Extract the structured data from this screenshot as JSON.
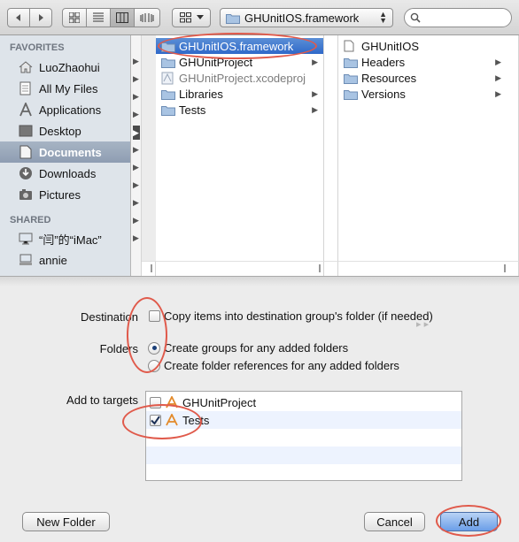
{
  "toolbar": {
    "path_label": "GHUnitIOS.framework",
    "search_placeholder": ""
  },
  "sidebar": {
    "favorites_header": "FAVORITES",
    "favorites": [
      {
        "label": "LuoZhaohui",
        "icon": "home-icon"
      },
      {
        "label": "All My Files",
        "icon": "all-files-icon"
      },
      {
        "label": "Applications",
        "icon": "applications-icon"
      },
      {
        "label": "Desktop",
        "icon": "desktop-icon"
      },
      {
        "label": "Documents",
        "icon": "documents-icon",
        "selected": true
      },
      {
        "label": "Downloads",
        "icon": "downloads-icon"
      },
      {
        "label": "Pictures",
        "icon": "pictures-icon"
      }
    ],
    "shared_header": "SHARED",
    "shared": [
      {
        "label": "“闫”的“iMac”",
        "icon": "imac-icon"
      },
      {
        "label": "annie",
        "icon": "computer-icon"
      }
    ]
  },
  "browser": {
    "column1": [
      {
        "label": "GHUnitIOS.framework",
        "icon": "folder-icon",
        "selected": true
      },
      {
        "label": "GHUnitProject",
        "icon": "folder-icon"
      },
      {
        "label": "GHUnitProject.xcodeproj",
        "icon": "xcodeproj-icon",
        "dim": true
      },
      {
        "label": "Libraries",
        "icon": "folder-icon"
      },
      {
        "label": "Tests",
        "icon": "folder-icon"
      }
    ],
    "column2": [
      {
        "label": "GHUnitIOS",
        "icon": "file-icon"
      },
      {
        "label": "Headers",
        "icon": "folder-icon"
      },
      {
        "label": "Resources",
        "icon": "folder-icon"
      },
      {
        "label": "Versions",
        "icon": "folder-icon"
      }
    ]
  },
  "options": {
    "destination_label": "Destination",
    "copy_items_label": "Copy items into destination group's folder (if needed)",
    "copy_items_checked": false,
    "folders_label": "Folders",
    "create_groups_label": "Create groups for any added folders",
    "create_refs_label": "Create folder references for any added folders",
    "folders_selected": "groups",
    "targets_label": "Add to targets",
    "targets": [
      {
        "label": "GHUnitProject",
        "checked": false
      },
      {
        "label": "Tests",
        "checked": true
      }
    ]
  },
  "buttons": {
    "new_folder": "New Folder",
    "cancel": "Cancel",
    "add": "Add"
  },
  "colors": {
    "selection_blue": "#2f69c9",
    "annotation_red": "#e05a4b",
    "sidebar_bg": "#dee4ea"
  }
}
